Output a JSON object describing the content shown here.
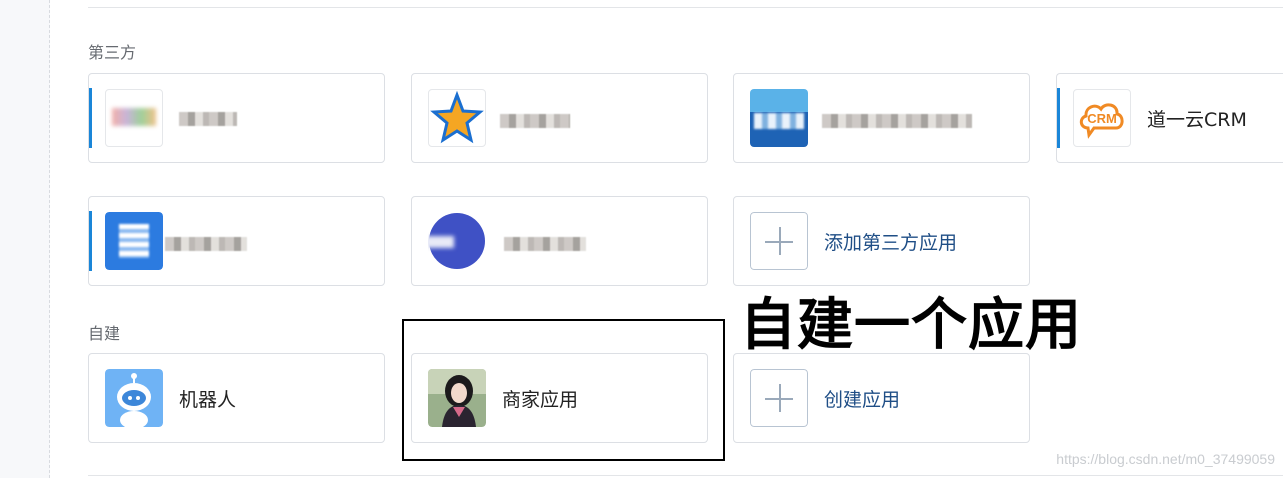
{
  "sections": {
    "third_party_title": "第三方",
    "self_built_title": "自建"
  },
  "third_party_apps": [
    {
      "label": "",
      "icon": "blurred-app-icon",
      "blurred": true
    },
    {
      "label": "",
      "icon": "star-icon",
      "blurred": true
    },
    {
      "label": "",
      "icon": "outlook-icon",
      "blurred": true
    },
    {
      "label": "道一云CRM",
      "icon": "crm-icon",
      "blurred": false
    },
    {
      "label": "",
      "icon": "blue-app-icon",
      "blurred": true
    },
    {
      "label": "",
      "icon": "purple-circle-icon",
      "blurred": true
    }
  ],
  "add_third_party_label": "添加第三方应用",
  "self_built_apps": [
    {
      "label": "机器人",
      "icon": "robot-icon"
    },
    {
      "label": "商家应用",
      "icon": "photo-avatar-icon"
    }
  ],
  "create_app_label": "创建应用",
  "annotation_text": "自建一个应用",
  "watermark": "https://blog.csdn.net/m0_37499059",
  "colors": {
    "accent_bar": "#1a86d8",
    "link_text": "#1f4e86",
    "card_border": "#dcdfe4"
  }
}
